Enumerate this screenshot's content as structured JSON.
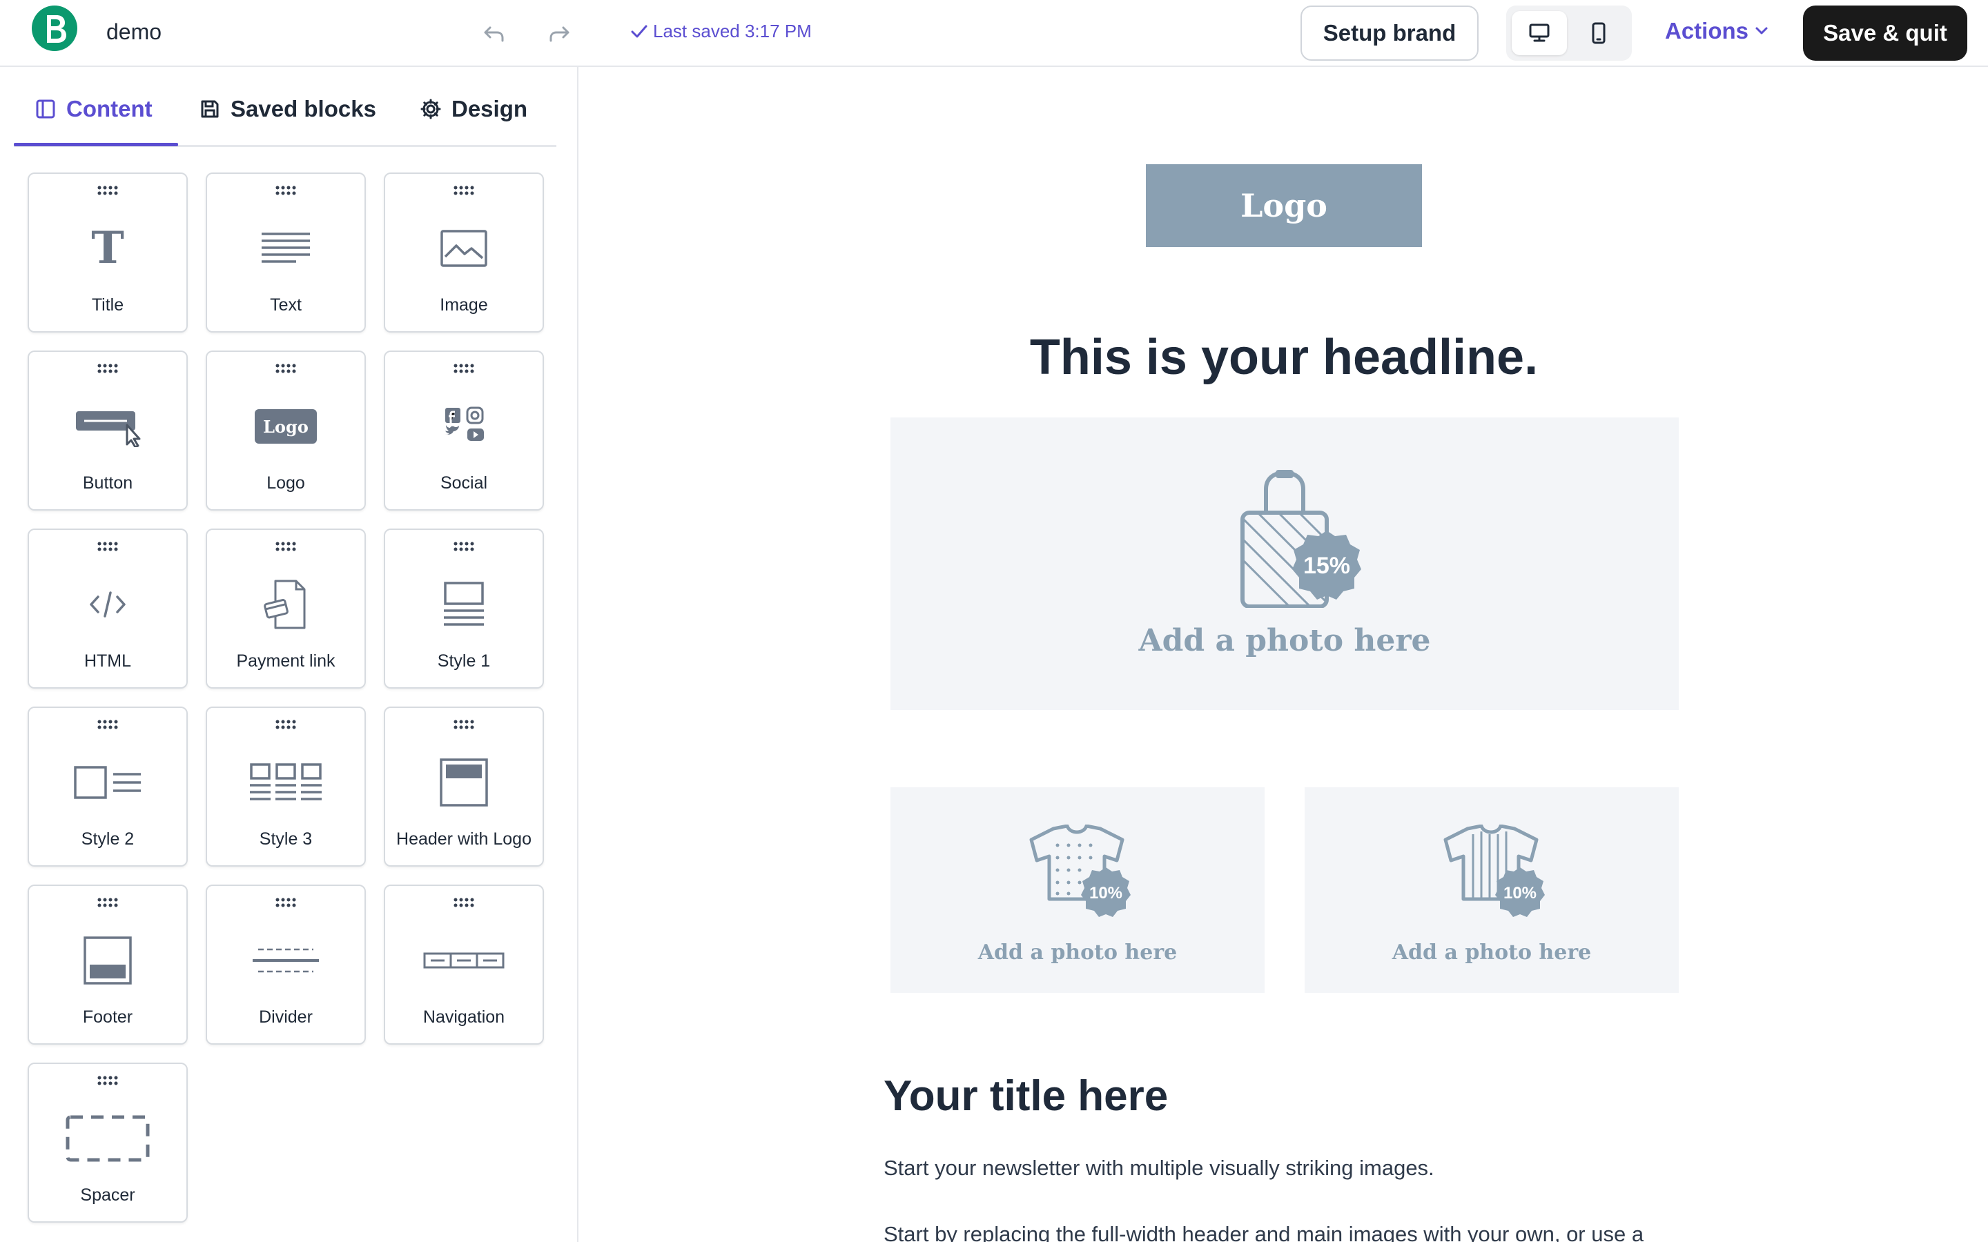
{
  "app": {
    "document_name": "demo",
    "brand_icon": "brevo-b-logo",
    "accent_color": "#5b4ed1",
    "brand_color": "#0b996e"
  },
  "toolbar": {
    "saved_status": "Last saved 3:17 PM",
    "setup_brand_label": "Setup brand",
    "actions_label": "Actions",
    "save_quit_label": "Save & quit",
    "device_options": [
      "desktop",
      "mobile"
    ],
    "selected_device": "desktop"
  },
  "sidebar": {
    "tabs": [
      {
        "label": "Content",
        "icon": "layout-panel-icon",
        "active": true
      },
      {
        "label": "Saved blocks",
        "icon": "floppy-disk-icon",
        "active": false
      },
      {
        "label": "Design",
        "icon": "gear-icon",
        "active": false
      }
    ],
    "blocks": [
      {
        "label": "Title",
        "icon": "title-icon"
      },
      {
        "label": "Text",
        "icon": "text-lines-icon"
      },
      {
        "label": "Image",
        "icon": "image-icon"
      },
      {
        "label": "Button",
        "icon": "button-cursor-icon"
      },
      {
        "label": "Logo",
        "icon": "logo-badge-icon"
      },
      {
        "label": "Social",
        "icon": "social-icons-icon"
      },
      {
        "label": "HTML",
        "icon": "code-icon"
      },
      {
        "label": "Payment link",
        "icon": "payment-document-icon"
      },
      {
        "label": "Style 1",
        "icon": "style-1-layout-icon"
      },
      {
        "label": "Style 2",
        "icon": "style-2-layout-icon"
      },
      {
        "label": "Style 3",
        "icon": "style-3-layout-icon"
      },
      {
        "label": "Header with Logo",
        "icon": "header-logo-icon"
      },
      {
        "label": "Footer",
        "icon": "footer-icon"
      },
      {
        "label": "Divider",
        "icon": "divider-icon"
      },
      {
        "label": "Navigation",
        "icon": "navigation-icon"
      },
      {
        "label": "Spacer",
        "icon": "spacer-icon"
      }
    ],
    "logo_icon_text": "Logo"
  },
  "canvas": {
    "logo_text": "Logo",
    "headline": "This is your headline.",
    "hero": {
      "discount": "15%",
      "text": "Add a photo here"
    },
    "photos": [
      {
        "discount": "10%",
        "text": "Add a photo here",
        "pattern": "dotted-tshirt-icon"
      },
      {
        "discount": "10%",
        "text": "Add a photo here",
        "pattern": "striped-tshirt-icon"
      }
    ],
    "title": "Your title here",
    "paragraph1": "Start your newsletter with multiple visually striking images.",
    "paragraph2": "Start by replacing the full-width header and main images with your own, or use a"
  }
}
